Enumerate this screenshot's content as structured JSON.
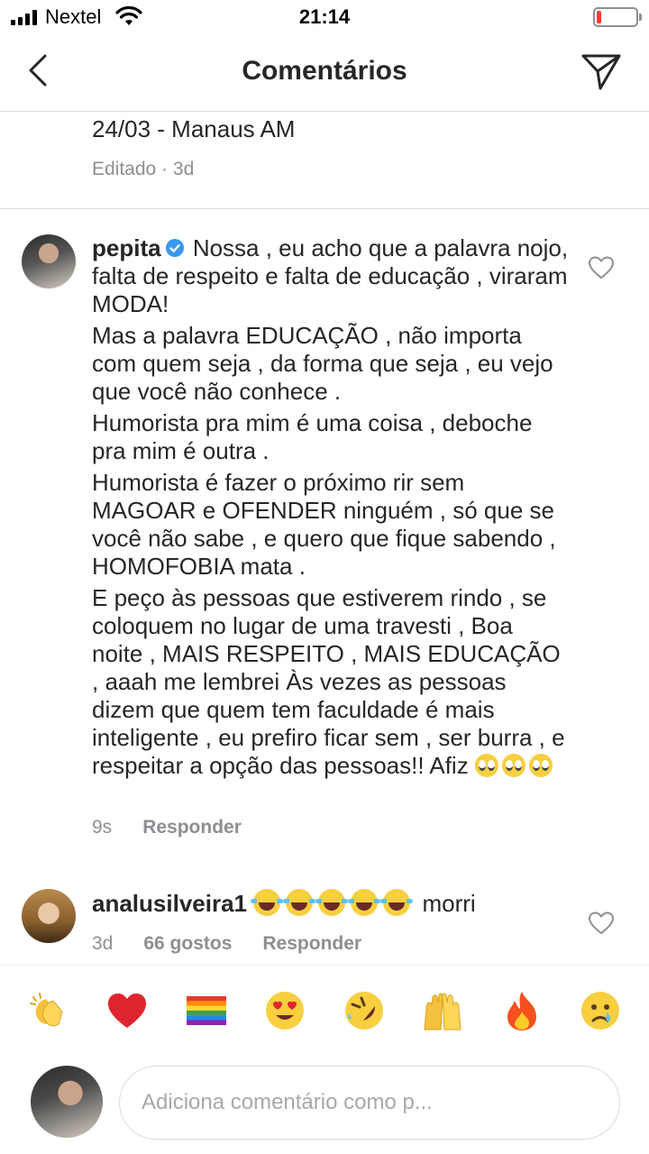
{
  "status_bar": {
    "carrier": "Nextel",
    "time": "21:14",
    "battery_percent": 8
  },
  "header": {
    "title": "Comentários"
  },
  "caption": {
    "line": "24/03 - Manaus AM",
    "meta": "Editado · 3d"
  },
  "comments": [
    {
      "username": "pepita",
      "verified": true,
      "paragraphs": [
        "Nossa , eu acho que a palavra nojo, falta de respeito e falta de educação , viraram MODA!",
        "Mas a palavra EDUCAÇÃO , não importa com quem seja , da forma que seja , eu vejo que você não conhece .",
        "Humorista pra mim é uma coisa , deboche pra mim é outra .",
        "Humorista é fazer o próximo rir sem MAGOAR e OFENDER ninguém , só que se você não sabe , e quero que fique sabendo , HOMOFOBIA mata .",
        "E peço às pessoas que estiverem rindo , se coloquem no lugar de uma travesti , Boa noite , MAIS RESPEITO , MAIS EDUCAÇÃO , aaah me lembrei Às vezes as pessoas dizem que quem tem faculdade é mais inteligente , eu prefiro ficar sem , ser burra , e respeitar a opção das pessoas!! Afiz"
      ],
      "trailing_emoji": [
        "face-with-rolling-eyes",
        "face-with-rolling-eyes",
        "face-with-rolling-eyes"
      ],
      "time": "9s",
      "reply_label": "Responder"
    },
    {
      "username": "analusilveira1",
      "verified": false,
      "leading_emoji": [
        "face-with-tears-of-joy",
        "face-with-tears-of-joy",
        "face-with-tears-of-joy",
        "face-with-tears-of-joy",
        "face-with-tears-of-joy"
      ],
      "text": "morri",
      "time": "3d",
      "likes": "66 gostos",
      "reply_label": "Responder"
    }
  ],
  "emoji_bar": [
    "clapping-hands",
    "red-heart",
    "rainbow-flag",
    "heart-eyes",
    "rolling-on-floor-laughing",
    "raising-hands",
    "fire",
    "crying-face"
  ],
  "comment_input": {
    "placeholder": "Adiciona comentário como p..."
  },
  "colors": {
    "text": "#262626",
    "secondary": "#8e8e93",
    "divider": "#dbdbdb",
    "verified": "#3897f0",
    "battery_low": "#ff3b30"
  }
}
